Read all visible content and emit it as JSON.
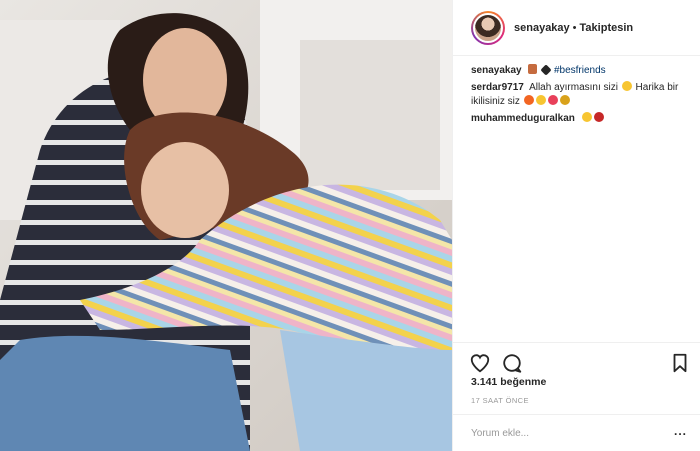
{
  "header": {
    "username": "senayakay",
    "separator": "•",
    "follow_status": "Takiptesin"
  },
  "comments": [
    {
      "user": "senayakay",
      "emoji": [
        "woman-couple",
        "heart-black"
      ],
      "tag": "#besfriends",
      "text": ""
    },
    {
      "user": "serdar9717",
      "text": "Allah ayırmasını sizi",
      "text2": "Harika bir ikilisiniz siz",
      "emoji_after_1": [
        "smile"
      ],
      "emoji_after_2": [
        "fire",
        "blush",
        "heart-eyes",
        "trophy"
      ]
    },
    {
      "user": "muhammeduguralkan",
      "emoji": [
        "smile",
        "rose"
      ],
      "text": ""
    }
  ],
  "stats": {
    "likes": "3.141 beğenme",
    "time": "17 SAAT ÖNCE"
  },
  "add_comment": {
    "placeholder": "Yorum ekle...",
    "more_label": "..."
  },
  "icons": {
    "like": "heart-outline-icon",
    "comment": "comment-bubble-icon",
    "save": "bookmark-icon"
  },
  "colors": {
    "tag": "#003569",
    "border": "#efefef",
    "meta_gray": "#999999"
  }
}
